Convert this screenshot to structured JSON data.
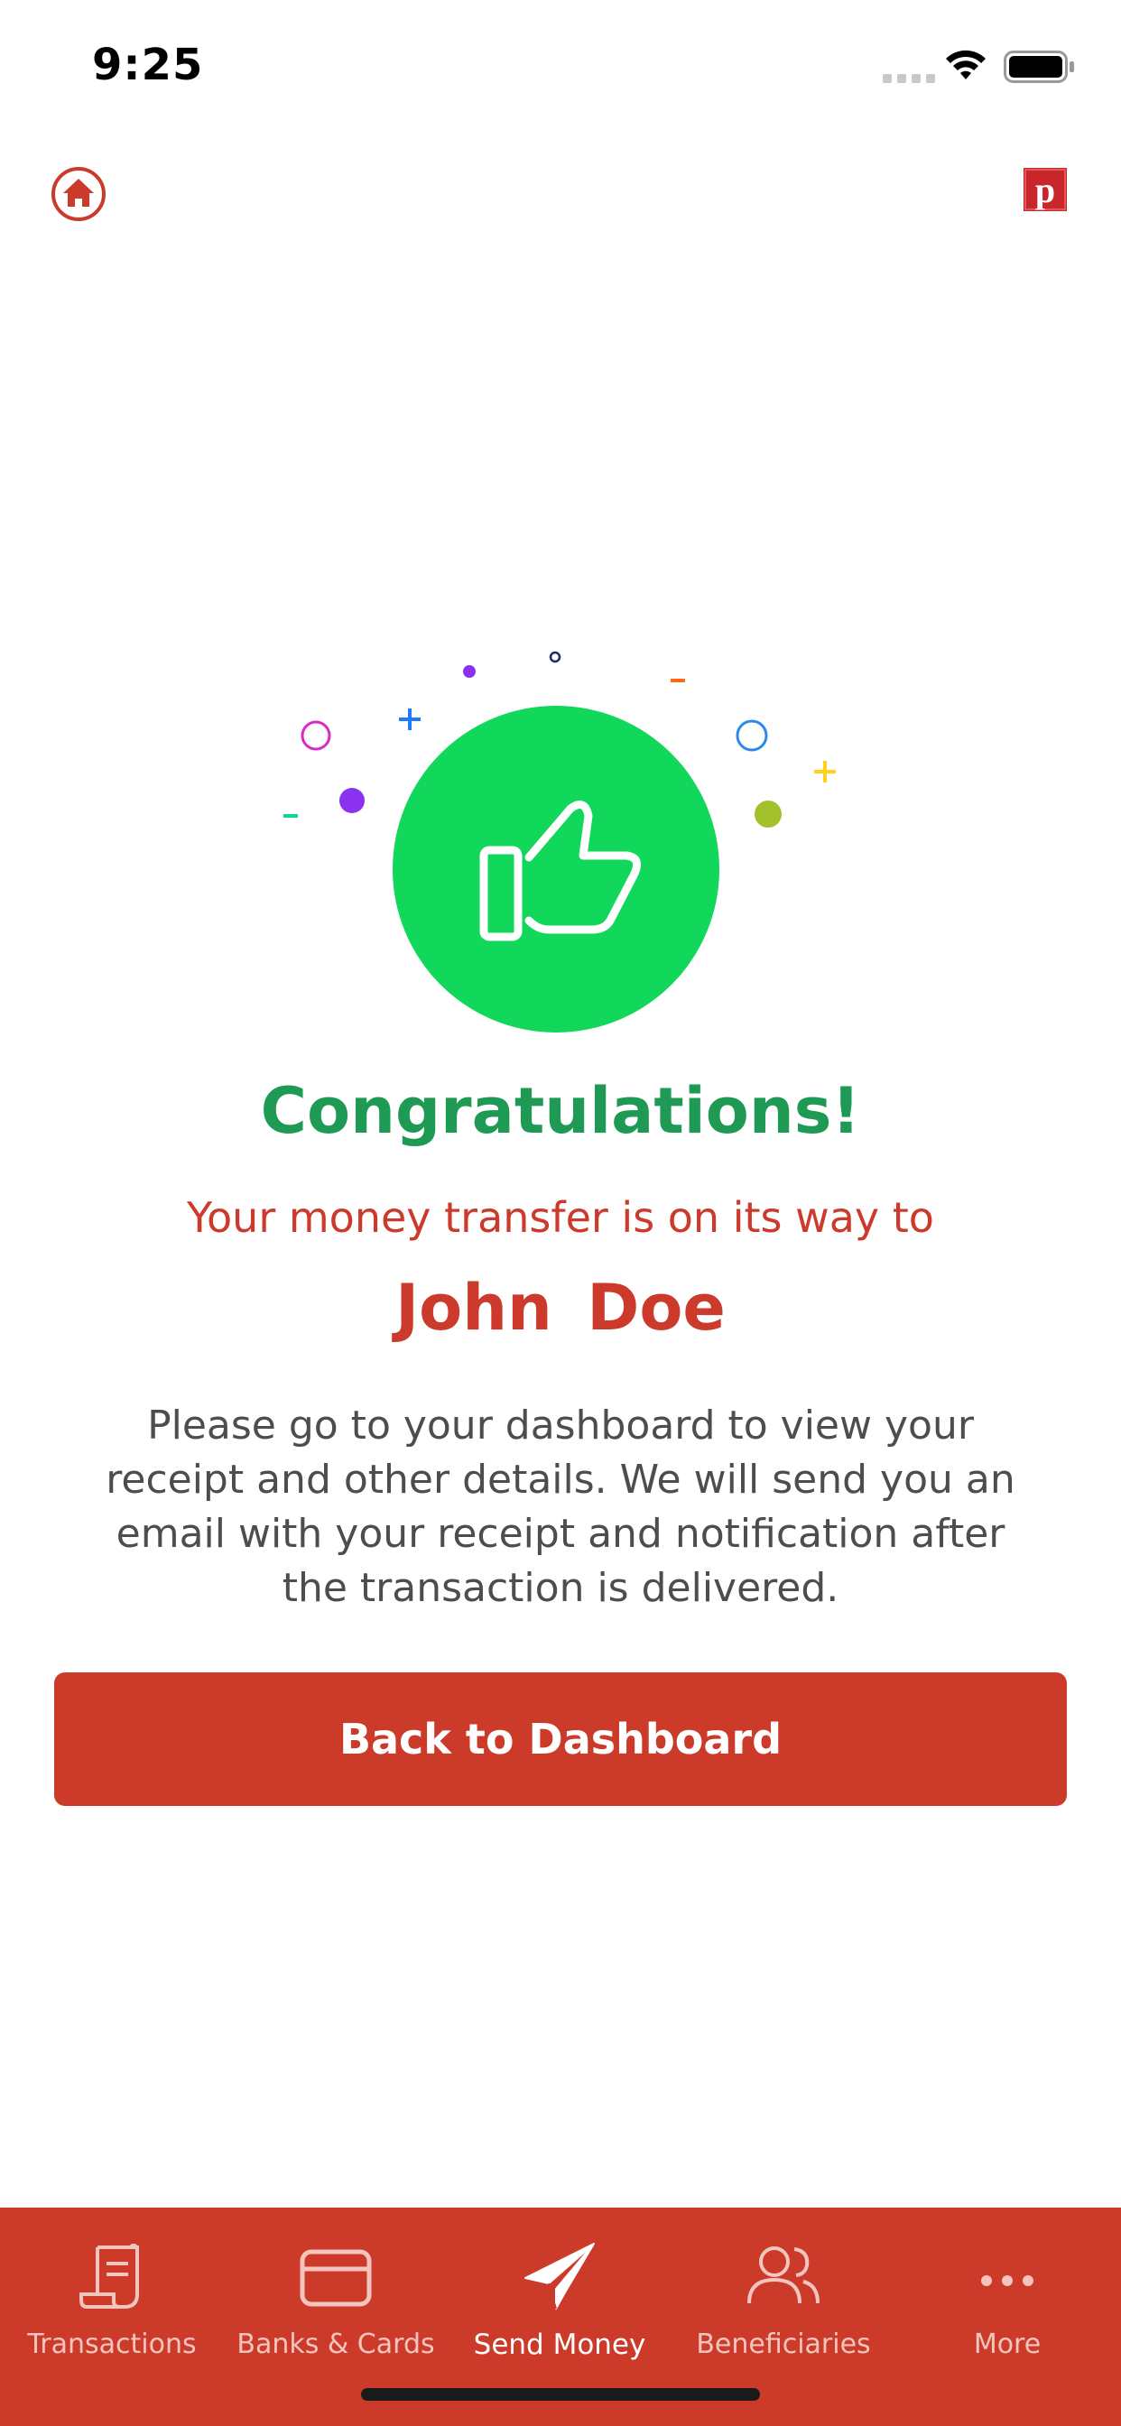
{
  "status_bar": {
    "time": "9:25",
    "icons": [
      "cellular-signal-icon",
      "wifi-icon",
      "battery-icon"
    ]
  },
  "header": {
    "home_icon": "home-icon",
    "brand_logo_letter": "p",
    "brand_color": "#cc3a2c"
  },
  "confirmation": {
    "title": "Congratulations!",
    "subtitle": "Your money transfer is on its way to",
    "recipient_name": "John  Doe",
    "message": "Please go to your dashboard to view your receipt and other details. We will send you an email with your receipt and notification after the transaction is delivered.",
    "icon": "thumbs-up-icon",
    "icon_bg_color": "#11d75a",
    "title_color": "#1f9a55"
  },
  "actions": {
    "back_to_dashboard": "Back to Dashboard"
  },
  "tabbar": {
    "bg_color": "#cc3a2a",
    "items": [
      {
        "label": "Transactions",
        "icon": "receipt-icon",
        "active": false
      },
      {
        "label": "Banks & Cards",
        "icon": "credit-card-icon",
        "active": false
      },
      {
        "label": "Send Money",
        "icon": "paper-plane-icon",
        "active": true
      },
      {
        "label": "Beneficiaries",
        "icon": "users-icon",
        "active": false
      },
      {
        "label": "More",
        "icon": "more-dots-icon",
        "active": false
      }
    ]
  }
}
